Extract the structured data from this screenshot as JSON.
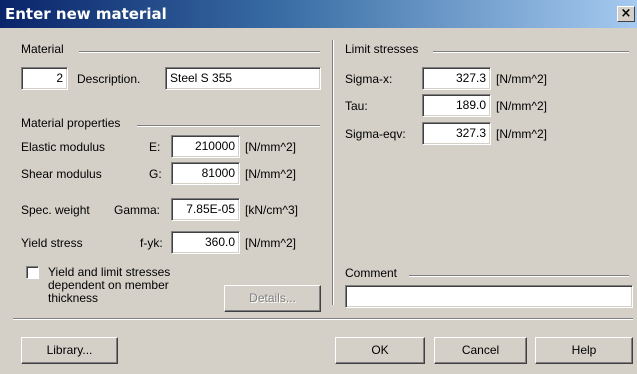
{
  "window": {
    "title": "Enter new material",
    "close_glyph": "×"
  },
  "material": {
    "group_label": "Material",
    "number": "2",
    "description_label": "Description.",
    "description_value": "Steel S 355"
  },
  "properties": {
    "group_label": "Material properties",
    "elastic": {
      "label": "Elastic modulus",
      "symbol": "E:",
      "value": "210000",
      "unit": "[N/mm^2]"
    },
    "shear": {
      "label": "Shear modulus",
      "symbol": "G:",
      "value": "81000",
      "unit": "[N/mm^2]"
    },
    "weight": {
      "label": "Spec. weight",
      "symbol": "Gamma:",
      "value": "7.85E-05",
      "unit": "[kN/cm^3]"
    },
    "yield": {
      "label": "Yield stress",
      "symbol": "f-yk:",
      "value": "360.0",
      "unit": "[N/mm^2]"
    }
  },
  "thickness": {
    "checked": false,
    "line1": "Yield and limit stresses",
    "line2": "dependent on member",
    "line3": "thickness",
    "details_label": "Details..."
  },
  "limits": {
    "group_label": "Limit stresses",
    "sigma_x": {
      "label": "Sigma-x:",
      "value": "327.3",
      "unit": "[N/mm^2]"
    },
    "tau": {
      "label": "Tau:",
      "value": "189.0",
      "unit": "[N/mm^2]"
    },
    "sigma_eqv": {
      "label": "Sigma-eqv:",
      "value": "327.3",
      "unit": "[N/mm^2]"
    }
  },
  "comment": {
    "group_label": "Comment",
    "value": ""
  },
  "buttons": {
    "library": "Library...",
    "ok": "OK",
    "cancel": "Cancel",
    "help": "Help"
  }
}
